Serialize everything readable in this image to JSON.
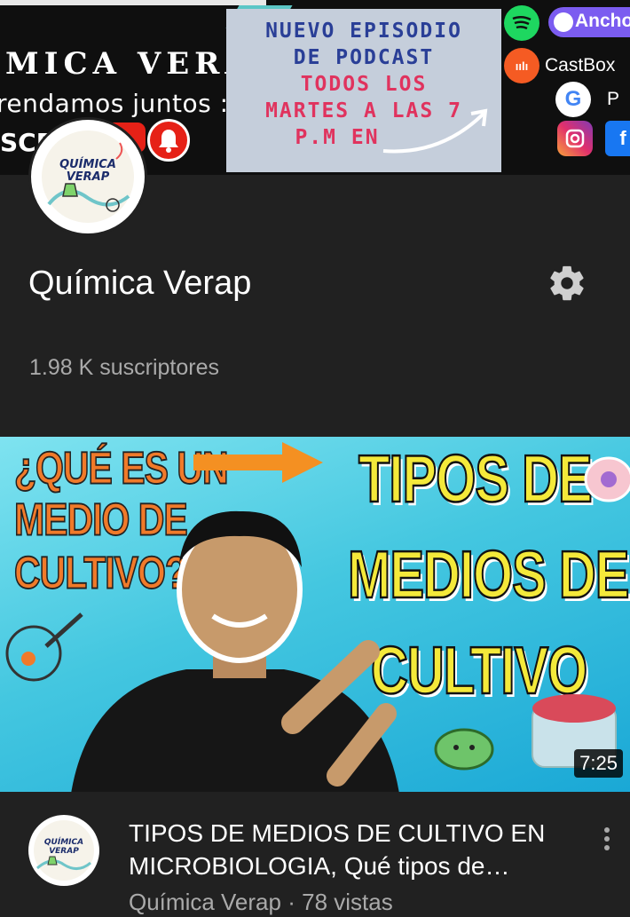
{
  "banner": {
    "title": "MICA VERAP",
    "subtitle": "rendamos juntos :)",
    "subscribe_partial": "SCRI",
    "podcast_lines": [
      "NUEVO EPISODIO",
      "DE PODCAST",
      "TODOS LOS",
      "MARTES A LAS 7",
      "P.M EN"
    ],
    "platforms": [
      {
        "name": "spotify-icon",
        "label": ""
      },
      {
        "name": "anchor-icon",
        "label": "Ancho"
      },
      {
        "name": "castbox-icon",
        "label": "CastBox"
      },
      {
        "name": "google-podcasts-icon",
        "label": "P"
      },
      {
        "name": "instagram-icon",
        "label": ""
      },
      {
        "name": "facebook-icon",
        "label": "f"
      }
    ],
    "colors": {
      "podcast_blue": "#2a3f97",
      "podcast_pink": "#e0335e",
      "card_bg": "#c5cedb"
    }
  },
  "channel": {
    "avatar_text": [
      "QUÍMICA",
      "VERAP"
    ],
    "name": "Química Verap",
    "subscribers": "1.98 K suscriptores",
    "settings_icon": "gear-icon"
  },
  "video": {
    "thumbnail": {
      "question_lines": [
        "¿QUÉ ES UN",
        "MEDIO DE",
        "CULTIVO?"
      ],
      "headline_lines": [
        "TIPOS DE",
        "MEDIOS DE",
        "CULTIVO"
      ]
    },
    "duration": "7:25",
    "title": "TIPOS DE MEDIOS DE CULTIVO EN MICROBIOLOGIA, Qué tipos de medios de cultivo existen",
    "channel_name": "Química Verap",
    "separator": "·",
    "views": "78 vistas",
    "menu_icon": "more-vert-icon"
  },
  "theme": {
    "background": "#212121",
    "secondary_text": "#aaaaaa",
    "accent_red": "#e62117"
  }
}
